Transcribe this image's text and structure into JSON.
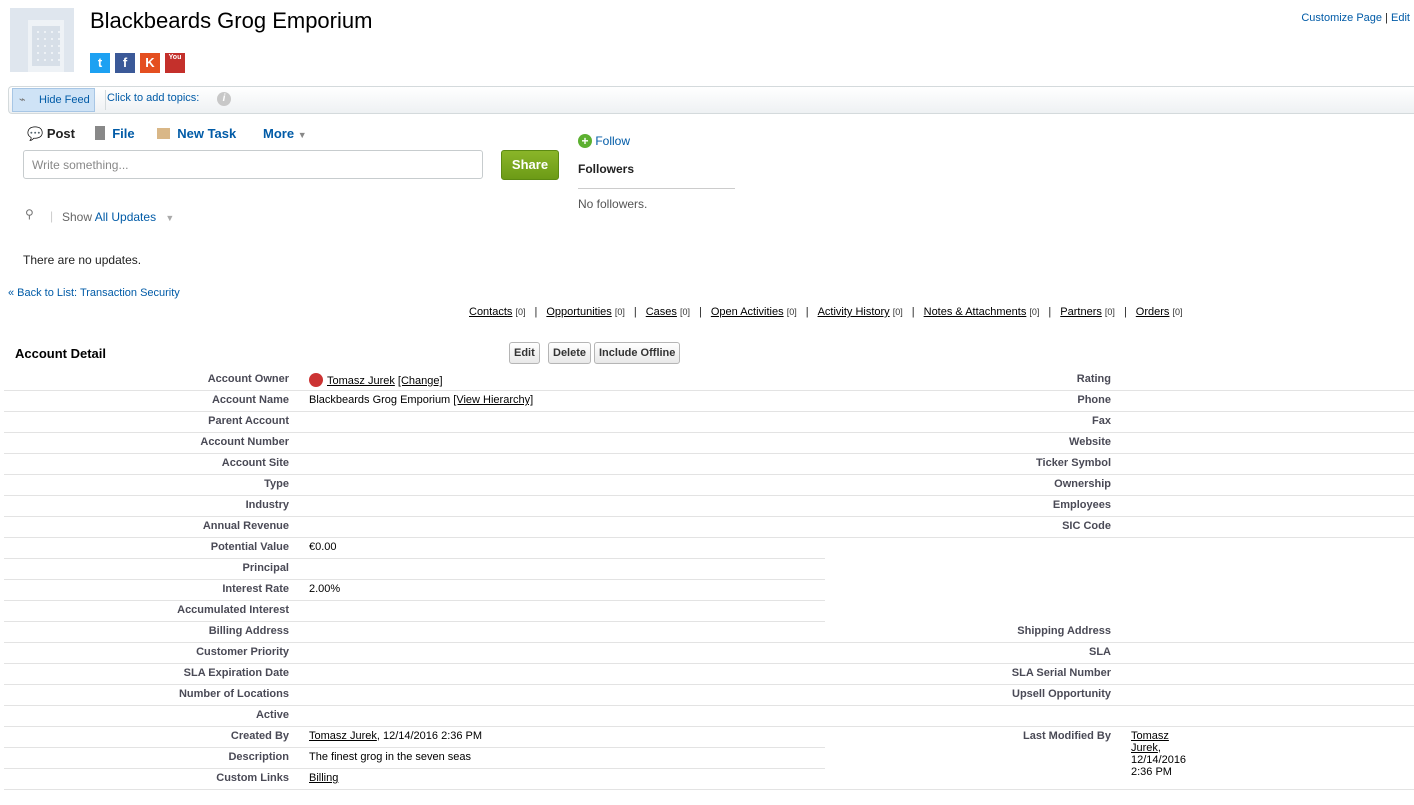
{
  "header": {
    "title": "Blackbeards Grog Emporium",
    "customize": "Customize Page",
    "sep": " | ",
    "edit": "Edit",
    "social": [
      {
        "name": "twitter",
        "glyph": "t",
        "color": "#1da1f2"
      },
      {
        "name": "facebook",
        "glyph": "f",
        "color": "#3b5998"
      },
      {
        "name": "klout",
        "glyph": "K",
        "color": "#e44f20"
      },
      {
        "name": "youtube",
        "glyph": "You",
        "color": "#c4302b"
      }
    ]
  },
  "feedbar": {
    "hide_feed": "Hide Feed",
    "topics": "Click to add topics:",
    "info": "i"
  },
  "publisher": {
    "post": "Post",
    "file": "File",
    "new_task": "New Task",
    "more": "More",
    "placeholder": "Write something...",
    "share": "Share"
  },
  "followers": {
    "follow": "Follow",
    "title": "Followers",
    "none": "No followers."
  },
  "filter": {
    "show": "Show",
    "value": "All Updates"
  },
  "feed_empty": "There are no updates.",
  "back": "« Back to List: Transaction Security",
  "related": [
    [
      "Contacts",
      "[0]"
    ],
    [
      "Opportunities",
      "[0]"
    ],
    [
      "Cases",
      "[0]"
    ],
    [
      "Open Activities",
      "[0]"
    ],
    [
      "Activity History",
      "[0]"
    ],
    [
      "Notes & Attachments",
      "[0]"
    ],
    [
      "Partners",
      "[0]"
    ],
    [
      "Orders",
      "[0]"
    ]
  ],
  "detail": {
    "title": "Account Detail",
    "buttons": [
      "Edit",
      "Delete",
      "Include Offline"
    ],
    "rows": [
      {
        "l": "Account Owner",
        "v": [
          {
            "u": "Tomasz Jurek"
          },
          {
            "t": " "
          },
          {
            "u": "[Change]"
          }
        ],
        "owner": true,
        "r": "Rating",
        "full": true
      },
      {
        "l": "Account Name",
        "v": [
          {
            "t": "Blackbeards Grog Emporium "
          },
          {
            "u": "[View Hierarchy]"
          }
        ],
        "r": "Phone",
        "full": true
      },
      {
        "l": "Parent Account",
        "r": "Fax",
        "full": true
      },
      {
        "l": "Account Number",
        "r": "Website",
        "full": true
      },
      {
        "l": "Account Site",
        "r": "Ticker Symbol",
        "full": true
      },
      {
        "l": "Type",
        "r": "Ownership",
        "full": true
      },
      {
        "l": "Industry",
        "r": "Employees",
        "full": true
      },
      {
        "l": "Annual Revenue",
        "r": "SIC Code",
        "full": true
      },
      {
        "l": "Potential Value",
        "v": [
          {
            "t": "€0.00"
          }
        ]
      },
      {
        "l": "Principal"
      },
      {
        "l": "Interest Rate",
        "v": [
          {
            "t": "2.00%"
          }
        ]
      },
      {
        "l": "Accumulated Interest"
      },
      {
        "l": "Billing Address",
        "r": "Shipping Address",
        "full": true
      },
      {
        "l": "Customer Priority",
        "r": "SLA",
        "full": true
      },
      {
        "l": "SLA Expiration Date",
        "r": "SLA Serial Number",
        "full": true
      },
      {
        "l": "Number of Locations",
        "r": "Upsell Opportunity",
        "full": true
      },
      {
        "l": "Active",
        "full": true
      },
      {
        "l": "Created By",
        "v": [
          {
            "u": "Tomasz Jurek"
          },
          {
            "t": ", 12/14/2016 2:36 PM"
          }
        ],
        "r": "Last Modified By",
        "rv": [
          {
            "u": "Tomasz Jurek"
          },
          {
            "t": ", 12/14/2016 2:36 PM"
          }
        ]
      },
      {
        "l": "Description",
        "v": [
          {
            "t": "The finest grog in the seven seas"
          }
        ]
      },
      {
        "l": "Custom Links",
        "v": [
          {
            "t": " "
          },
          {
            "u": "Billing"
          }
        ],
        "full": true
      }
    ]
  }
}
